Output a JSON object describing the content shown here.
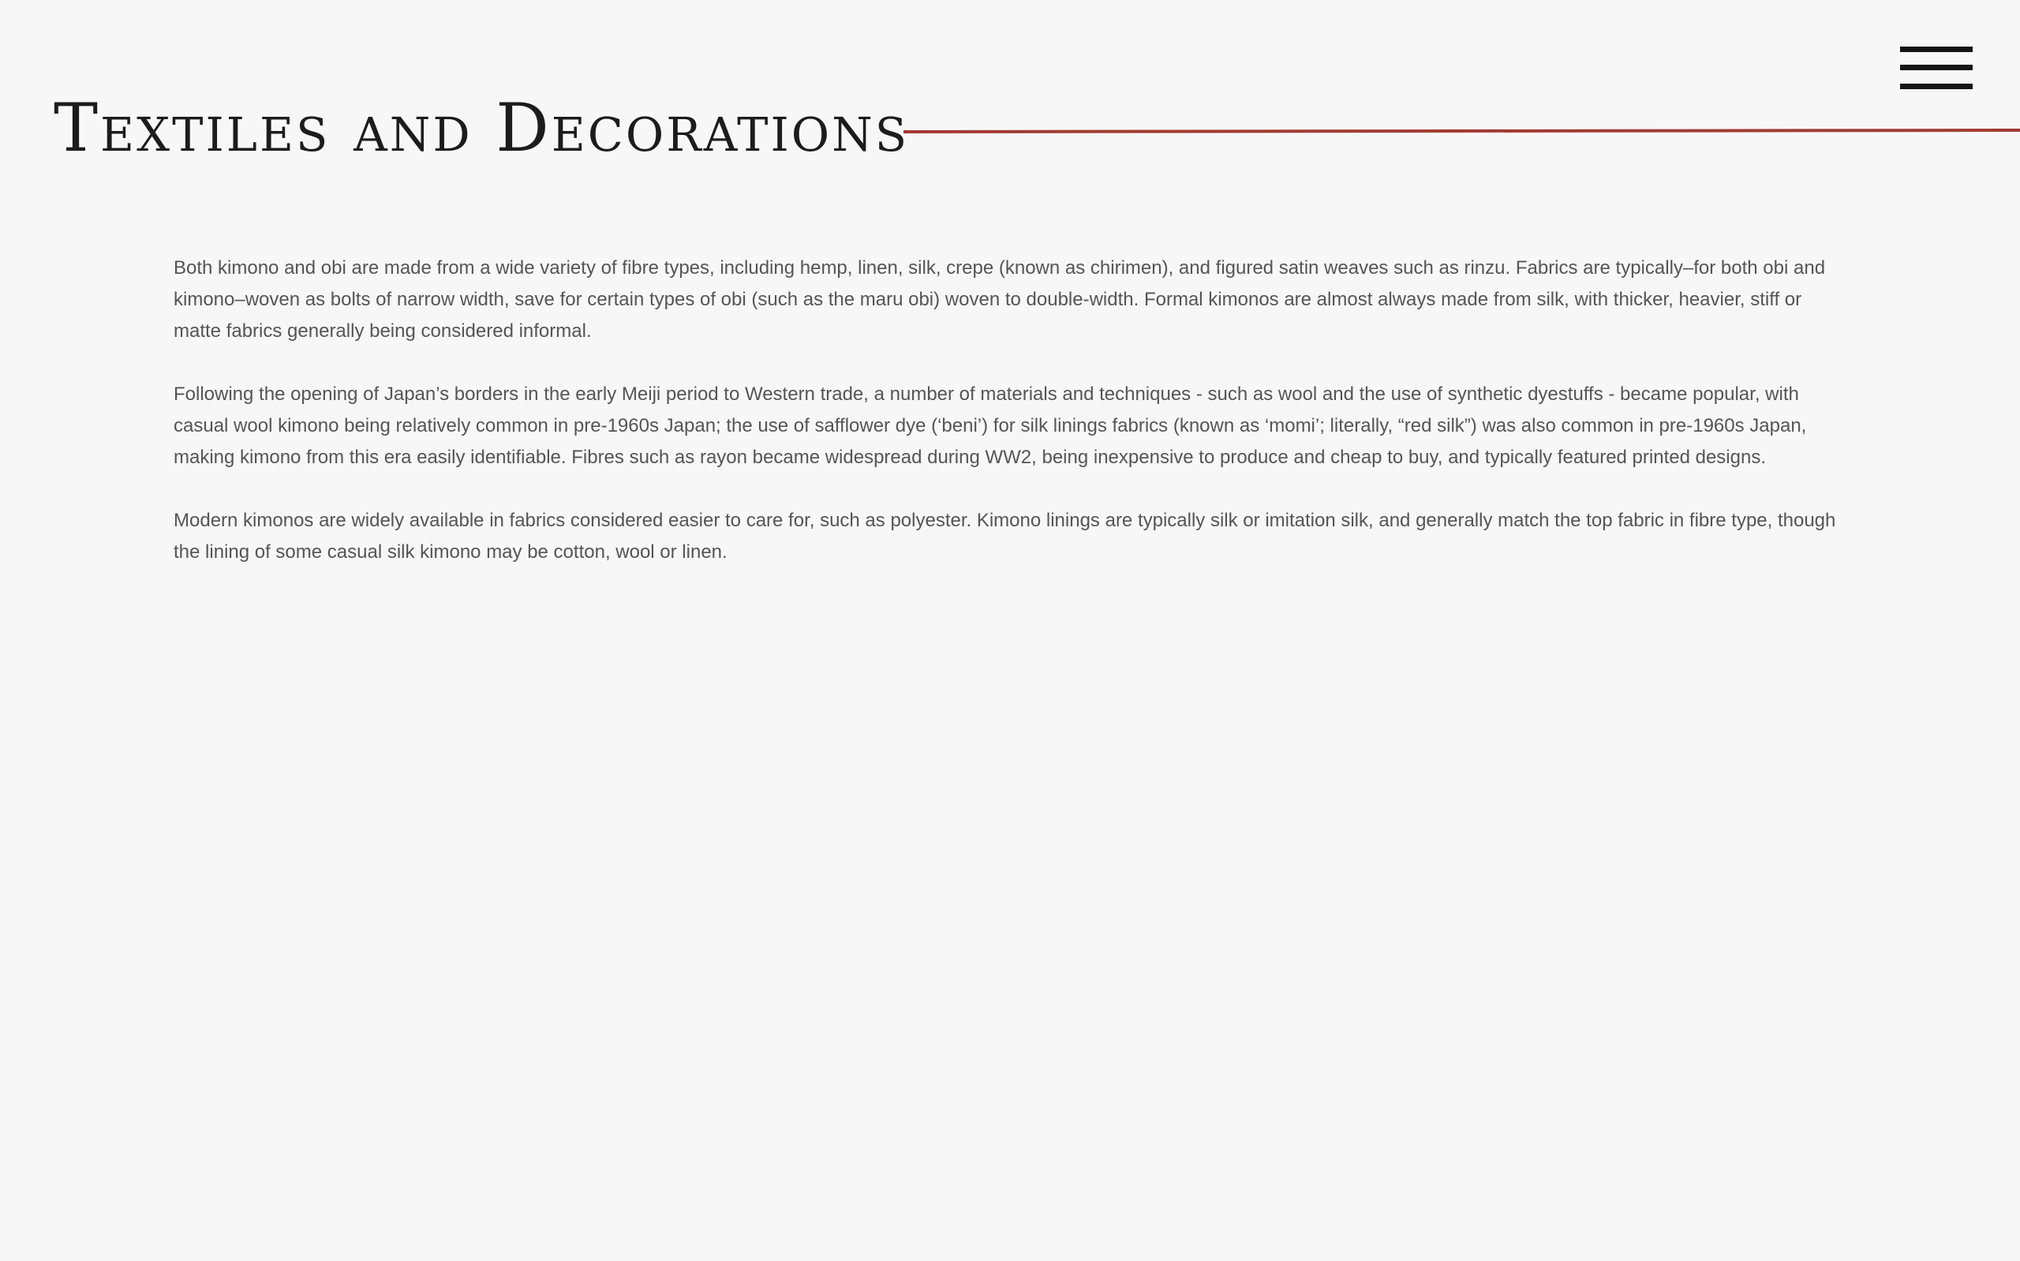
{
  "header": {
    "title": "Textiles and Decorations",
    "accent_color": "#a23b32",
    "menu_icon": "hamburger-menu-icon"
  },
  "content": {
    "paragraphs": [
      "Both kimono and obi are made from a wide variety of fibre types, including hemp, linen, silk, crepe (known as chirimen), and figured satin weaves such as rinzu. Fabrics are typically–for both obi and kimono–woven as bolts of narrow width, save for certain types of obi (such as the maru obi) woven to double-width. Formal kimonos are almost always made from silk, with thicker, heavier, stiff or matte fabrics generally being considered informal.",
      "Following the opening of Japan’s borders in the early Meiji period to Western trade, a number of materials and techniques - such as wool and the use of synthetic dyestuffs - became popular, with casual wool kimono being relatively common in pre-1960s Japan; the use of safflower dye (‘beni’) for silk linings fabrics (known as ‘momi’; literally, “red silk”) was also common in pre-1960s Japan, making kimono from this era easily identifiable. Fibres such as rayon became widespread during WW2, being inexpensive to produce and cheap to buy, and typically featured printed designs.",
      "Modern kimonos are widely available in fabrics considered easier to care for, such as polyester. Kimono linings are typically silk or imitation silk, and generally match the top fabric in fibre type, though the lining of some casual silk kimono may be cotton, wool or linen."
    ]
  }
}
